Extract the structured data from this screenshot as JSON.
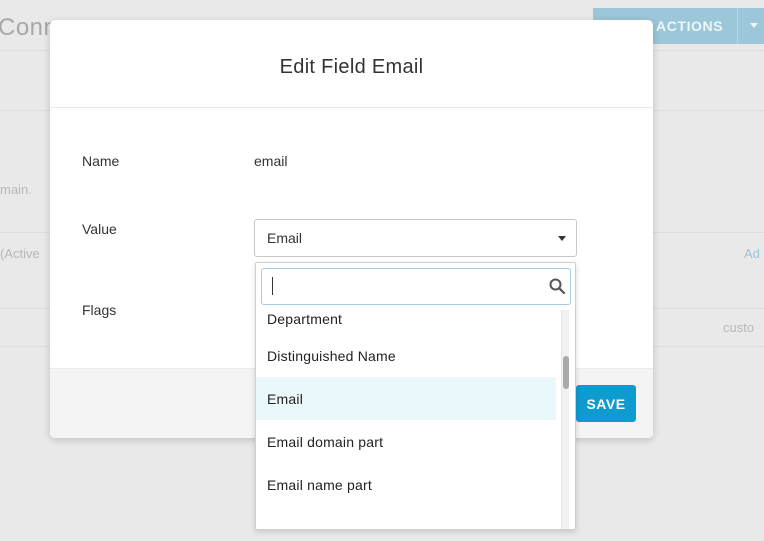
{
  "background": {
    "title": "Conn",
    "actions_label": "ACTIONS",
    "fragments": [
      "Conn",
      "main.",
      "(Active",
      "Ad",
      "custo"
    ]
  },
  "modal": {
    "title": "Edit Field Email",
    "name_label": "Name",
    "name_value": "email",
    "value_label": "Value",
    "value_selected": "Email",
    "flags_label": "Flags",
    "save_label": "SAVE"
  },
  "dropdown": {
    "search_value": "",
    "options": [
      {
        "label": "Department",
        "selected": false
      },
      {
        "label": "Distinguished Name",
        "selected": false
      },
      {
        "label": "Email",
        "selected": true
      },
      {
        "label": "Email domain part",
        "selected": false
      },
      {
        "label": "Email name part",
        "selected": false
      }
    ]
  },
  "colors": {
    "primary": "#0e9bd0",
    "selected_option_bg": "#eaf8fb"
  },
  "icons": {
    "search": "search-icon",
    "caret": "chevron-down-icon"
  }
}
